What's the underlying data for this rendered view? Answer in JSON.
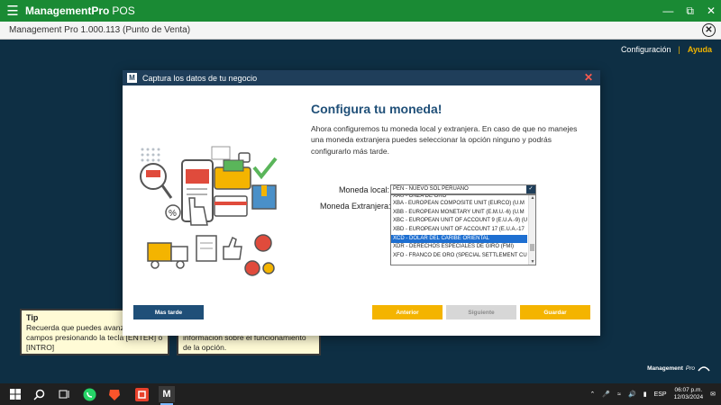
{
  "app": {
    "name": "ManagementPro",
    "name_suffix": "POS",
    "subtitle": "Management Pro 1.000.113 (Punto de Venta)"
  },
  "nav": {
    "config": "Configuración",
    "separator": "|",
    "help": "Ayuda"
  },
  "tips": {
    "left_title": "Tip",
    "left_text": "Recuerda que puedes avanzar entre campos presionando la tecla [ENTER] o [INTRO]",
    "right_text": "información sobre el funcionamiento de la opción."
  },
  "brand_bottom": {
    "name": "Management",
    "suffix": "Pro"
  },
  "modal": {
    "title": "Captura los datos de tu negocio",
    "heading": "Configura tu moneda!",
    "description": "Ahora configuremos tu moneda local y extranjera. En caso de que no manejes una moneda extranjera puedes seleccionar la opción ninguno y podrás configurarlo más tarde.",
    "local_label": "Moneda local:",
    "local_value": "PEN - NUEVO SOL PERUANO",
    "foreign_label": "Moneda Extranjera:",
    "options": [
      "XAU - ONZA DE ORO",
      "XBA - EUROPEAN COMPOSITE UNIT (EURCO) (U.M",
      "XBB - EUROPEAN MONETARY UNIT (E.M.U.-6) (U.M",
      "XBC - EUROPEAN UNIT OF ACCOUNT 9 (E.U.A.-9) (U",
      "XBD - EUROPEAN UNIT OF ACCOUNT 17 (E.U.A.-17",
      "XCD - DOLAR DEL CARIBE ORIENTAL",
      "XDR - DERECHOS ESPECIALES DE GIRO (FMI)",
      "XFO - FRANCO DE ORO (SPECIAL SETTLEMENT CU"
    ],
    "selected_index": 5,
    "buttons": {
      "later": "Mas tarde",
      "previous": "Anterior",
      "next": "Siguiente",
      "save": "Guardar"
    }
  },
  "taskbar": {
    "language": "ESP",
    "time": "06:07 p.m.",
    "date": "12/03/2024"
  },
  "colors": {
    "app_green": "#1a8a34",
    "background": "#0e2f44",
    "modal_titlebar": "#1f3e5a",
    "heading": "#1f4f78",
    "accent_yellow": "#f4b400",
    "selection_blue": "#1e6fd1"
  },
  "icons": {
    "menu": "hamburger-icon",
    "window_minimize": "minimize-icon",
    "window_restore": "restore-icon",
    "window_close": "close-icon",
    "subheader_close": "close-circle-icon",
    "modal_logo": "management-pro-logo",
    "modal_close": "close-icon",
    "dropdown": "chevron-down-icon",
    "taskbar_apps": [
      "windows-start-icon",
      "search-icon",
      "task-view-icon",
      "whatsapp-icon",
      "brave-icon",
      "app-icon",
      "management-pro-icon"
    ],
    "tray": [
      "chevron-up-icon",
      "microphone-icon",
      "wifi-icon",
      "volume-icon",
      "battery-icon"
    ]
  }
}
